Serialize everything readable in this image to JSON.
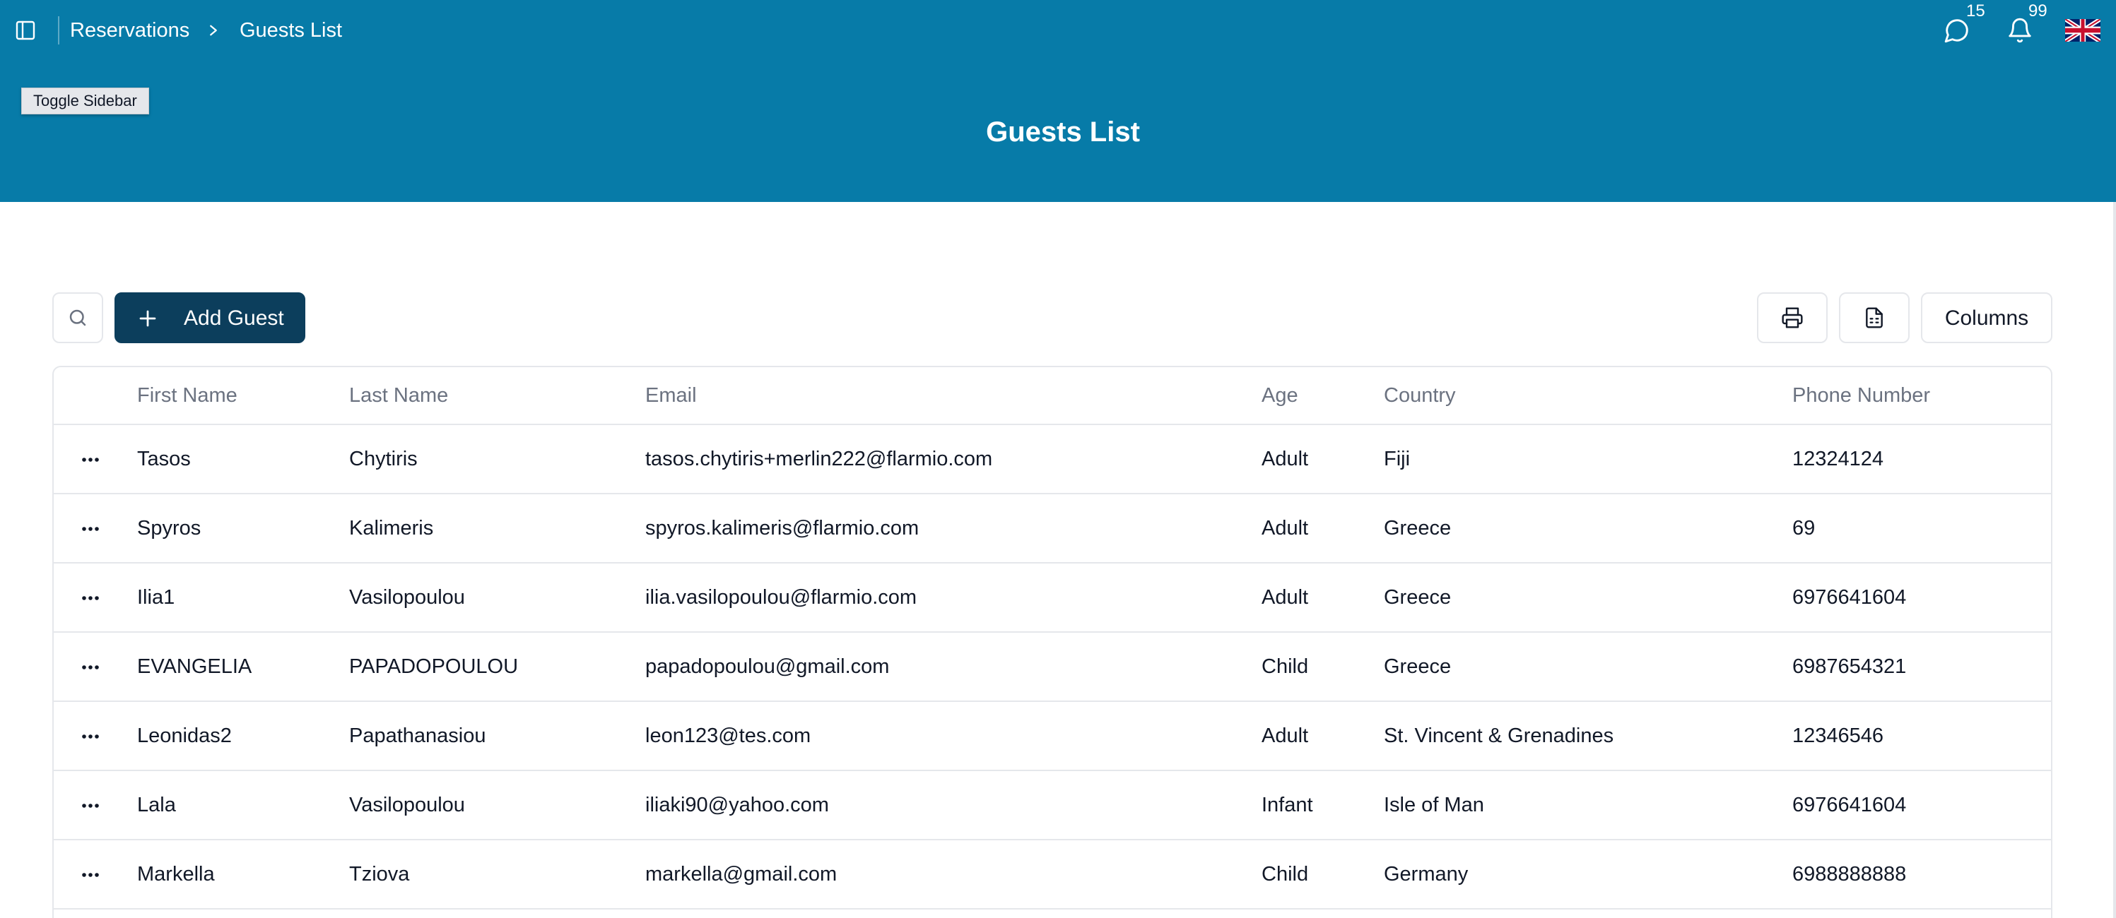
{
  "breadcrumb": {
    "parent": "Reservations",
    "current": "Guests List"
  },
  "notifications": {
    "messages_count": "15",
    "alerts_count": "99"
  },
  "tooltip": {
    "text": "Toggle Sidebar"
  },
  "page": {
    "title": "Guests List"
  },
  "toolbar": {
    "add_label": "Add Guest",
    "columns_label": "Columns"
  },
  "table": {
    "headers": {
      "first_name": "First Name",
      "last_name": "Last Name",
      "email": "Email",
      "age": "Age",
      "country": "Country",
      "phone": "Phone Number"
    },
    "rows": [
      {
        "first_name": "Tasos",
        "last_name": "Chytiris",
        "email": "tasos.chytiris+merlin222@flarmio.com",
        "age": "Adult",
        "country": "Fiji",
        "phone": "12324124"
      },
      {
        "first_name": "Spyros",
        "last_name": "Kalimeris",
        "email": "spyros.kalimeris@flarmio.com",
        "age": "Adult",
        "country": "Greece",
        "phone": "69"
      },
      {
        "first_name": "Ilia1",
        "last_name": "Vasilopoulou",
        "email": "ilia.vasilopoulou@flarmio.com",
        "age": "Adult",
        "country": "Greece",
        "phone": "6976641604"
      },
      {
        "first_name": "EVANGELIA",
        "last_name": "PAPADOPOULOU",
        "email": "papadopoulou@gmail.com",
        "age": "Child",
        "country": "Greece",
        "phone": "6987654321"
      },
      {
        "first_name": "Leonidas2",
        "last_name": "Papathanasiou",
        "email": "leon123@tes.com",
        "age": "Adult",
        "country": "St. Vincent & Grenadines",
        "phone": "12346546"
      },
      {
        "first_name": "Lala",
        "last_name": "Vasilopoulou",
        "email": "iliaki90@yahoo.com",
        "age": "Infant",
        "country": "Isle of Man",
        "phone": "6976641604"
      },
      {
        "first_name": "Markella",
        "last_name": "Tziova",
        "email": "markella@gmail.com",
        "age": "Child",
        "country": "Germany",
        "phone": "6988888888"
      }
    ]
  },
  "icons": {
    "sidebar_toggle": "sidebar-icon",
    "breadcrumb_separator": "chevron-right-icon",
    "messages": "chat-bubble-icon",
    "alerts": "bell-icon",
    "language": "uk-flag-icon",
    "search": "search-icon",
    "add": "plus-icon",
    "print": "printer-icon",
    "export": "file-spreadsheet-icon",
    "row_actions": "more-horizontal-icon"
  },
  "colors": {
    "header_bg": "#077ba8",
    "primary_button": "#0c3e5c",
    "border": "#e5e7eb",
    "muted_text": "#6b7280"
  }
}
